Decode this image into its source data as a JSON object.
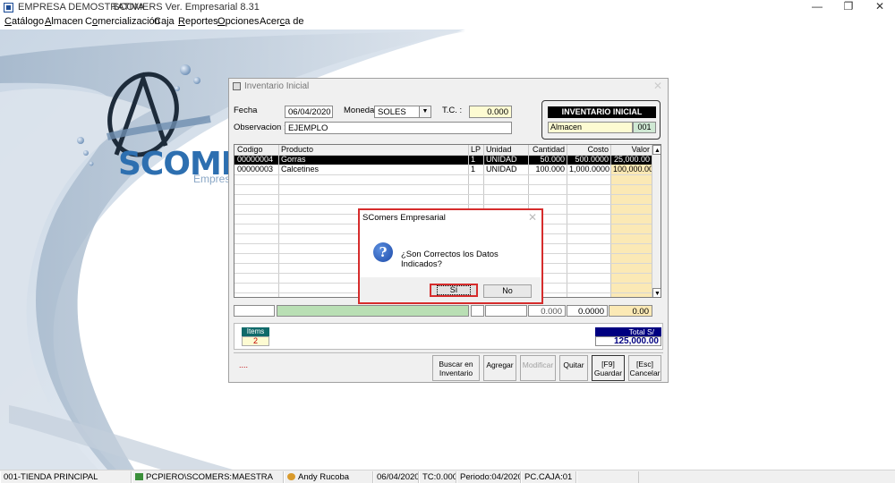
{
  "window": {
    "company": "EMPRESA DEMOSTRATIVA",
    "version": "SCOMERS Ver. Empresarial  8.31",
    "controls": {
      "minimize": "—",
      "restore": "❐",
      "close": "✕"
    }
  },
  "menu": [
    {
      "pre": "",
      "u": "C",
      "post": "atálogo"
    },
    {
      "pre": "",
      "u": "A",
      "post": "lmacen"
    },
    {
      "pre": "C",
      "u": "o",
      "post": "mercialización"
    },
    {
      "pre": "Ca",
      "u": "j",
      "post": "a"
    },
    {
      "pre": "",
      "u": "R",
      "post": "eportes"
    },
    {
      "pre": "",
      "u": "O",
      "post": "pciones"
    },
    {
      "pre": "Acer",
      "u": "c",
      "post": "a de"
    }
  ],
  "logo": {
    "text": "SCOMER",
    "sub": "Empres"
  },
  "inventory_window": {
    "title": "Inventario Inicial",
    "fecha_label": "Fecha",
    "fecha_value": "06/04/2020",
    "moneda_label": "Moneda :",
    "moneda_value": "SOLES",
    "tc_label": "T.C. :",
    "tc_value": "0.000",
    "observacion_label": "Observacion :",
    "observacion_value": "EJEMPLO",
    "box_title": "INVENTARIO INICIAL",
    "box_almacen": "Almacen",
    "box_almacen_code": "001",
    "columns": [
      "Codigo",
      "Producto",
      "LP",
      "Unidad",
      "Cantidad",
      "Costo",
      "Valor"
    ],
    "rows": [
      {
        "codigo": "00000004",
        "producto": "Gorras",
        "lp": "1",
        "unidad": "UNIDAD",
        "cantidad": "50.000",
        "costo": "500.0000",
        "valor": "25,000.00"
      },
      {
        "codigo": "00000003",
        "producto": "Calcetines",
        "lp": "1",
        "unidad": "UNIDAD",
        "cantidad": "100.000",
        "costo": "1,000.0000",
        "valor": "100,000.00"
      }
    ],
    "totals_row": {
      "cantidad": "0.000",
      "costo": "0.0000",
      "valor": "0.00"
    },
    "items_label": "Items",
    "items_value": "2",
    "total_label": "Total S/",
    "total_value": "125,000.00",
    "dots": "....",
    "buttons": {
      "buscar_1": "Buscar en",
      "buscar_2": "Inventario",
      "agregar": "Agregar",
      "modificar": "Modificar",
      "quitar": "Quitar",
      "guardar_1": "[F9]",
      "guardar_2": "Guardar",
      "cancelar_1": "[Esc]",
      "cancelar_2": "Cancelar"
    }
  },
  "dialog": {
    "title": "SComers Empresarial",
    "message": "¿Son Correctos los Datos Indicados?",
    "yes": "Sí",
    "no": "No"
  },
  "statusbar": {
    "tienda": "001-TIENDA PRINCIPAL",
    "db": "PCPIERO\\SCOMERS:MAESTRA",
    "user": "Andy Rucoba",
    "date": "06/04/2020",
    "tc": "TC:0.000",
    "periodo": "Periodo:04/2020",
    "caja": "PC.CAJA:01"
  },
  "colors": {
    "dialog_highlight": "#d62c2c",
    "total_header": "#000080",
    "items_header": "#106a6a",
    "valor_column": "#fbe9b5",
    "yellow_field": "#fdfbd2"
  }
}
